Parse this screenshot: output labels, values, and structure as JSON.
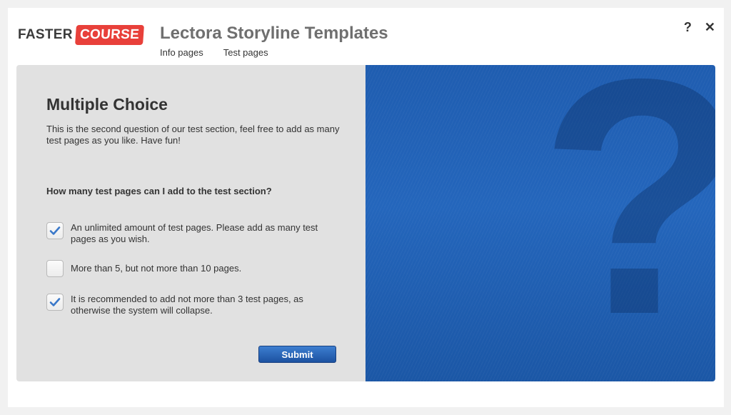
{
  "brand": {
    "faster": "FASTER",
    "course": "COURSE",
    "course_color": "#e8403a"
  },
  "header": {
    "title": "Lectora Storyline Templates",
    "nav": [
      "Info pages",
      "Test pages"
    ],
    "help_icon": "?",
    "close_icon": "✕"
  },
  "question": {
    "title": "Multiple Choice",
    "intro": "This is the second question of our test section, feel free to add as many test pages as you like. Have fun!",
    "prompt": "How many test pages can I add to the test section?",
    "options": [
      {
        "label": "An unlimited amount of test pages. Please add as many test pages as you wish.",
        "checked": true
      },
      {
        "label": "More than 5, but not more than 10 pages.",
        "checked": false
      },
      {
        "label": "It is recommended to add not more than 3 test pages, as otherwise the system will collapse.",
        "checked": true
      }
    ],
    "submit_label": "Submit"
  },
  "decoration": {
    "big_symbol": "?",
    "panel_color": "#2466bc"
  }
}
